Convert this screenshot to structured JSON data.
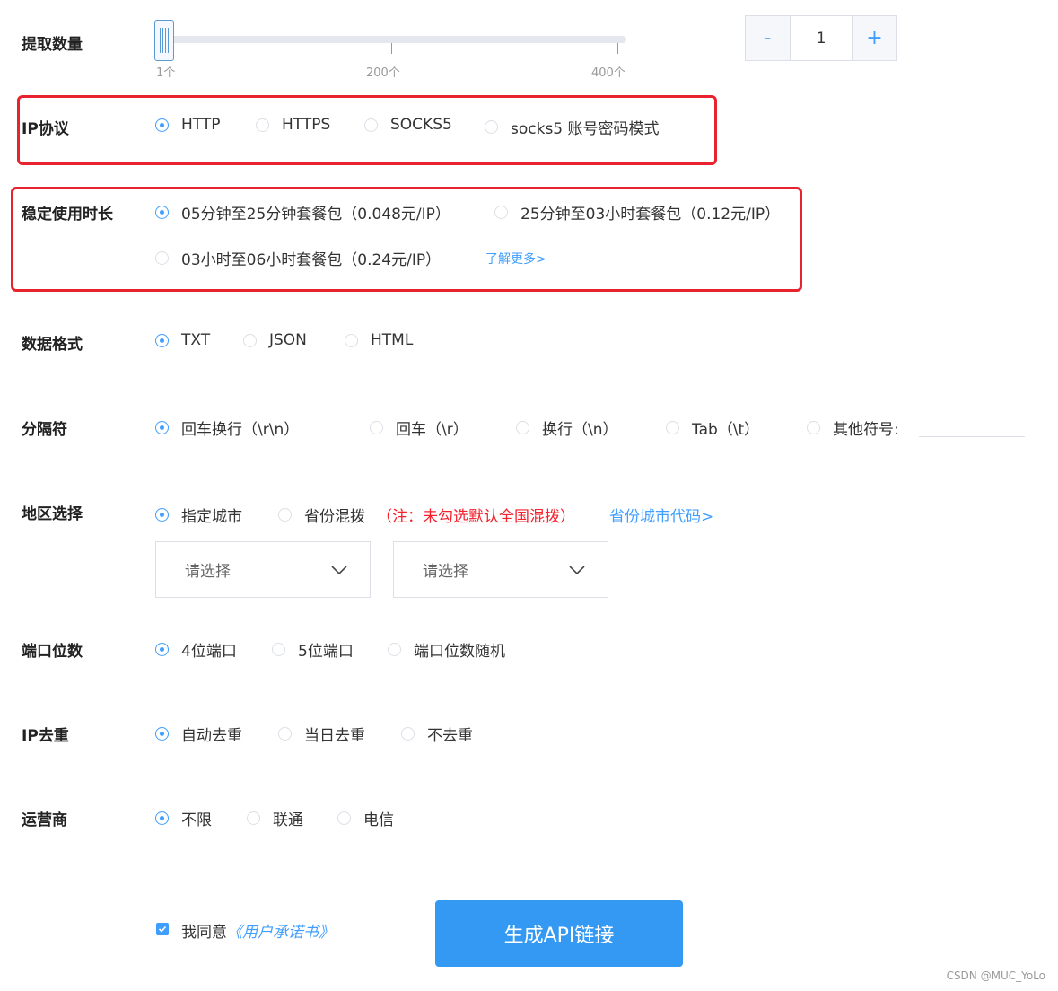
{
  "quantity": {
    "label": "提取数量",
    "slider_ticks": [
      "1个",
      "200个",
      "400个"
    ],
    "slider_value": 1,
    "stepper": {
      "minus": "-",
      "value": "1",
      "plus": "+"
    }
  },
  "protocol": {
    "label": "IP协议",
    "options": [
      "HTTP",
      "HTTPS",
      "SOCKS5",
      "socks5 账号密码模式"
    ],
    "selected": "HTTP"
  },
  "duration": {
    "label": "稳定使用时长",
    "options": [
      "05分钟至25分钟套餐包（0.048元/IP）",
      "25分钟至03小时套餐包（0.12元/IP）",
      "03小时至06小时套餐包（0.24元/IP）"
    ],
    "selected": "05分钟至25分钟套餐包（0.048元/IP）",
    "more_link": "了解更多>"
  },
  "format": {
    "label": "数据格式",
    "options": [
      "TXT",
      "JSON",
      "HTML"
    ],
    "selected": "TXT"
  },
  "separator": {
    "label": "分隔符",
    "options": [
      "回车换行（\\r\\n）",
      "回车（\\r）",
      "换行（\\n）",
      "Tab（\\t）",
      "其他符号:"
    ],
    "selected": "回车换行（\\r\\n）",
    "other_value": ""
  },
  "region": {
    "label": "地区选择",
    "options": [
      "指定城市",
      "省份混拨"
    ],
    "selected": "指定城市",
    "note": "（注：未勾选默认全国混拨）",
    "codes_link": "省份城市代码>",
    "province_placeholder": "请选择",
    "city_placeholder": "请选择"
  },
  "port": {
    "label": "端口位数",
    "options": [
      "4位端口",
      "5位端口",
      "端口位数随机"
    ],
    "selected": "4位端口"
  },
  "dedup": {
    "label": "IP去重",
    "options": [
      "自动去重",
      "当日去重",
      "不去重"
    ],
    "selected": "自动去重"
  },
  "carrier": {
    "label": "运营商",
    "options": [
      "不限",
      "联通",
      "电信"
    ],
    "selected": "不限"
  },
  "agreement": {
    "checked": true,
    "text": "我同意",
    "link": "《用户承诺书》"
  },
  "generate_button": "生成API链接",
  "watermark": "CSDN @MUC_YoLo",
  "colors": {
    "accent": "#409eff",
    "highlight_box": "#e8232f",
    "note": "#f5222d",
    "button": "#3399f3"
  }
}
